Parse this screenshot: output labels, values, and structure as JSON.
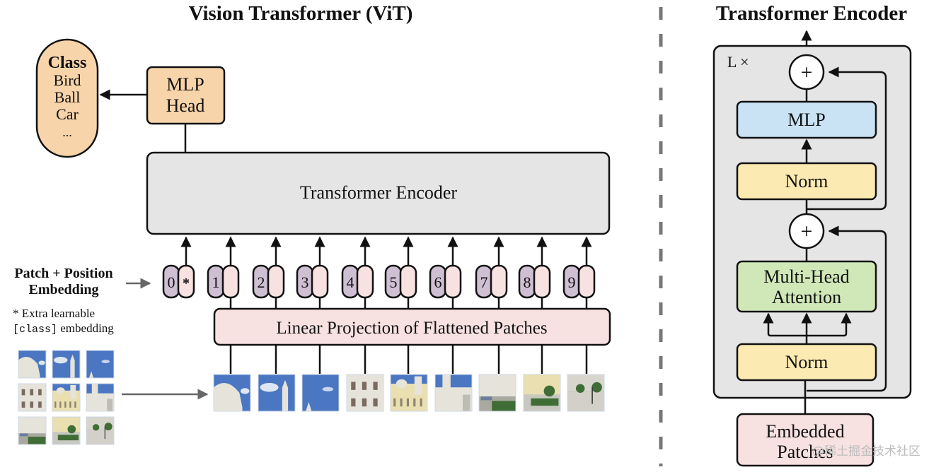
{
  "colors": {
    "class_fill": "#f8d4aa",
    "mlp_head_fill": "#f8d4aa",
    "encoder_fill": "#e5e5e5",
    "projection_fill": "#f7e1e1",
    "position_token_fill": "#cfbfd3",
    "patch_token_fill": "#f7e1e1",
    "mlp_fill": "#c9e2f4",
    "norm_fill": "#fbeab2",
    "attention_fill": "#d0e8b8",
    "embedded_patches_fill": "#f7e1e1",
    "block_bg": "#e5e5e5",
    "sky": "#4a76c2",
    "building": "#e6e3da",
    "building_yellow": "#e9dfb0",
    "green": "#3f6d35"
  },
  "vit": {
    "title": "Vision Transformer (ViT)",
    "class_box": {
      "heading": "Class",
      "items": [
        "Bird",
        "Ball",
        "Car",
        "..."
      ]
    },
    "mlp_head": {
      "line1": "MLP",
      "line2": "Head"
    },
    "transformer_encoder": "Transformer Encoder",
    "embedding_label": {
      "line1": "Patch + Position",
      "line2": "Embedding"
    },
    "extra_note": {
      "line1": "* Extra learnable",
      "code": "[class]",
      "line2_rest": " embedding"
    },
    "tokens": [
      {
        "position": "0",
        "patch": "*"
      },
      {
        "position": "1",
        "patch": ""
      },
      {
        "position": "2",
        "patch": ""
      },
      {
        "position": "3",
        "patch": ""
      },
      {
        "position": "4",
        "patch": ""
      },
      {
        "position": "5",
        "patch": ""
      },
      {
        "position": "6",
        "patch": ""
      },
      {
        "position": "7",
        "patch": ""
      },
      {
        "position": "8",
        "patch": ""
      },
      {
        "position": "9",
        "patch": ""
      }
    ],
    "linear_projection": "Linear Projection of Flattened Patches",
    "image_patches": [
      {
        "name": "patch-1-dome",
        "sky": 0.6,
        "scene": "dome"
      },
      {
        "name": "patch-2-tower-sky",
        "sky": 0.85,
        "scene": "tower"
      },
      {
        "name": "patch-3-sky-spire",
        "sky": 0.9,
        "scene": "spire"
      },
      {
        "name": "patch-4-facade",
        "sky": 0.0,
        "scene": "facade"
      },
      {
        "name": "patch-5-palace",
        "sky": 0.25,
        "scene": "palace"
      },
      {
        "name": "patch-6-tower-wing",
        "sky": 0.35,
        "scene": "wing"
      },
      {
        "name": "patch-7-courtyard",
        "sky": 0.0,
        "scene": "courtyard"
      },
      {
        "name": "patch-8-garden",
        "sky": 0.0,
        "scene": "garden"
      },
      {
        "name": "patch-9-plaza",
        "sky": 0.0,
        "scene": "plaza"
      }
    ]
  },
  "encoder_detail": {
    "title": "Transformer Encoder",
    "repeat_label": "L ×",
    "add_symbol": "+",
    "mlp": "MLP",
    "norm_top": "Norm",
    "attention": {
      "line1": "Multi-Head",
      "line2": "Attention"
    },
    "norm_bottom": "Norm",
    "embedded_patches": {
      "line1": "Embedded",
      "line2": "Patches"
    }
  },
  "watermark": "@稀土掘金技术社区"
}
